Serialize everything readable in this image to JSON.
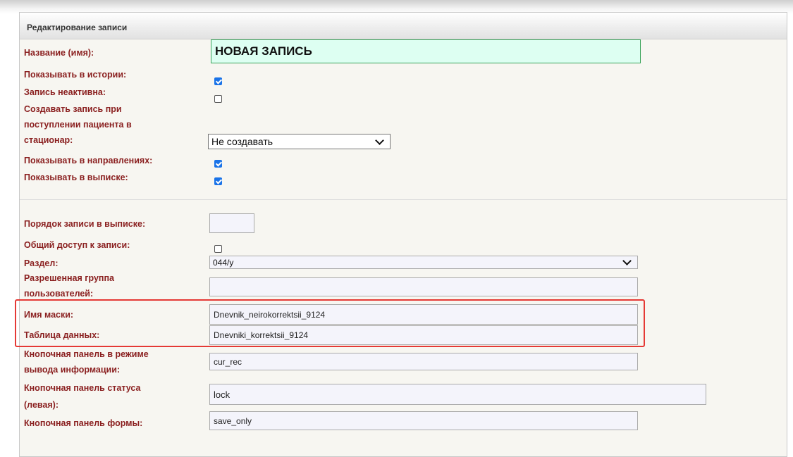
{
  "form": {
    "title": "Редактирование записи",
    "fields": {
      "name": {
        "label": "Название (имя):",
        "value": "НОВАЯ ЗАПИСЬ"
      },
      "show_history": {
        "label": "Показывать в истории:",
        "checked": true
      },
      "inactive": {
        "label": "Запись неактивна:",
        "checked": false
      },
      "create_on_admission": {
        "label_lines": [
          "Создавать запись при",
          "поступлении пациента в",
          "стационар:"
        ],
        "value": "Не создавать"
      },
      "show_directions": {
        "label": "Показывать в направлениях:",
        "checked": true
      },
      "show_extract": {
        "label": "Показывать в выписке:",
        "checked": true
      },
      "extract_order": {
        "label": "Порядок записи в выписке:",
        "value": ""
      },
      "shared_access": {
        "label": "Общий доступ к записи:",
        "checked": false
      },
      "section": {
        "label": "Раздел:",
        "value": "044/у"
      },
      "allowed_group": {
        "label_lines": [
          "Разрешенная группа",
          "пользователей:"
        ],
        "value": ""
      },
      "mask_name": {
        "label": "Имя маски:",
        "value": "Dnevnik_neirokorrektsii_9124"
      },
      "data_table": {
        "label": "Таблица данных:",
        "value": "Dnevniki_korrektsii_9124"
      },
      "info_toolbar": {
        "label_lines": [
          "Кнопочная панель в режиме",
          "вывода информации:"
        ],
        "value": "cur_rec"
      },
      "status_toolbar": {
        "label_lines": [
          "Кнопочная панель статуса",
          "(левая):"
        ],
        "value": "lock"
      },
      "form_toolbar": {
        "label": "Кнопочная панель формы:",
        "value": "save_only"
      }
    }
  },
  "colors": {
    "label": "#8a1f1f",
    "highlight": "#e53935",
    "title_input_bg": "#ddfff2",
    "checkbox_on": "#1a73e8"
  }
}
